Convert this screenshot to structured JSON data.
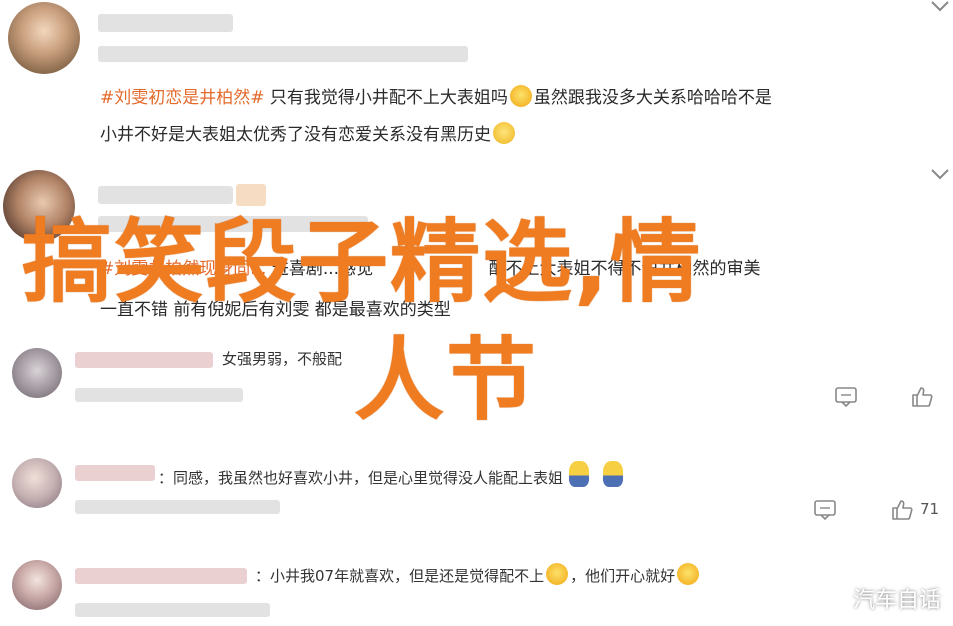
{
  "comments": [
    {
      "topic": "#刘雯初恋是井柏然#",
      "text_line1": "只有我觉得小井配不上大表姐吗",
      "text_line1_tail": "虽然跟我没多大关系哈哈哈不是",
      "text_line2": "小井不好是大表姐太优秀了没有恋爱关系没有黑历史"
    },
    {
      "line1_left": "#刘雯井柏然现身同...",
      "line1_mid": "进喜剧...感觉",
      "line1_right": "配不上大表姐不得不说井柏然的审美",
      "line2": "一直不错 前有倪妮后有刘雯 都是最喜欢的类型"
    },
    {
      "text": "女强男弱，不般配"
    },
    {
      "text": "：同感，我虽然也好喜欢小井，但是心里觉得没人能配上表姐",
      "likes": "71"
    },
    {
      "text": "：小井我07年就喜欢，但是还是觉得配不上",
      "text_tail": "，他们开心就好"
    }
  ],
  "headline": {
    "line1": "搞笑段子精选,情",
    "line2": "人节"
  },
  "watermark": "汽车自话",
  "icons": [
    "chevron-down-icon",
    "comment-icon",
    "thumbs-up-icon"
  ],
  "colors": {
    "topic": "#e46a2b",
    "headline": "#f07c22"
  }
}
